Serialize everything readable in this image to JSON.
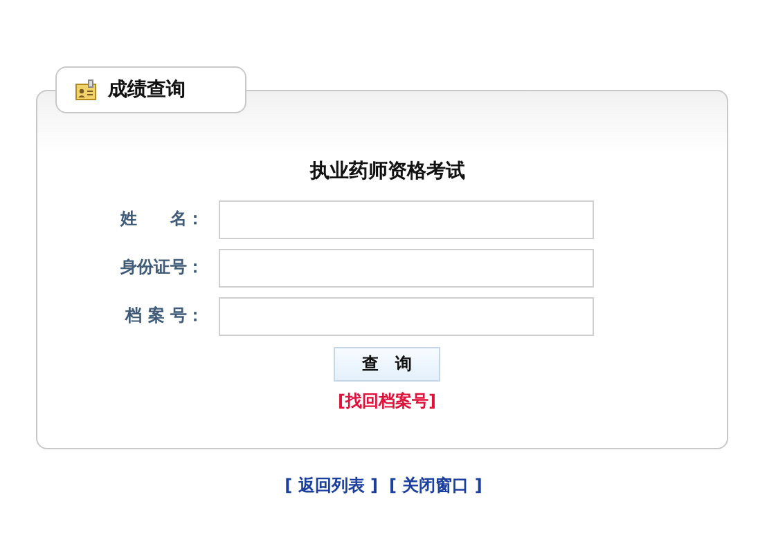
{
  "tab": {
    "title": "成绩查询"
  },
  "form": {
    "title": "执业药师资格考试",
    "fields": [
      {
        "label": "姓　　名："
      },
      {
        "label": "身份证号："
      },
      {
        "label": "档 案 号："
      }
    ],
    "submit": "查　询",
    "recover_link": "[找回档案号]"
  },
  "footer_links": [
    "[ 返回列表 ]",
    "[ 关闭窗口 ]"
  ]
}
